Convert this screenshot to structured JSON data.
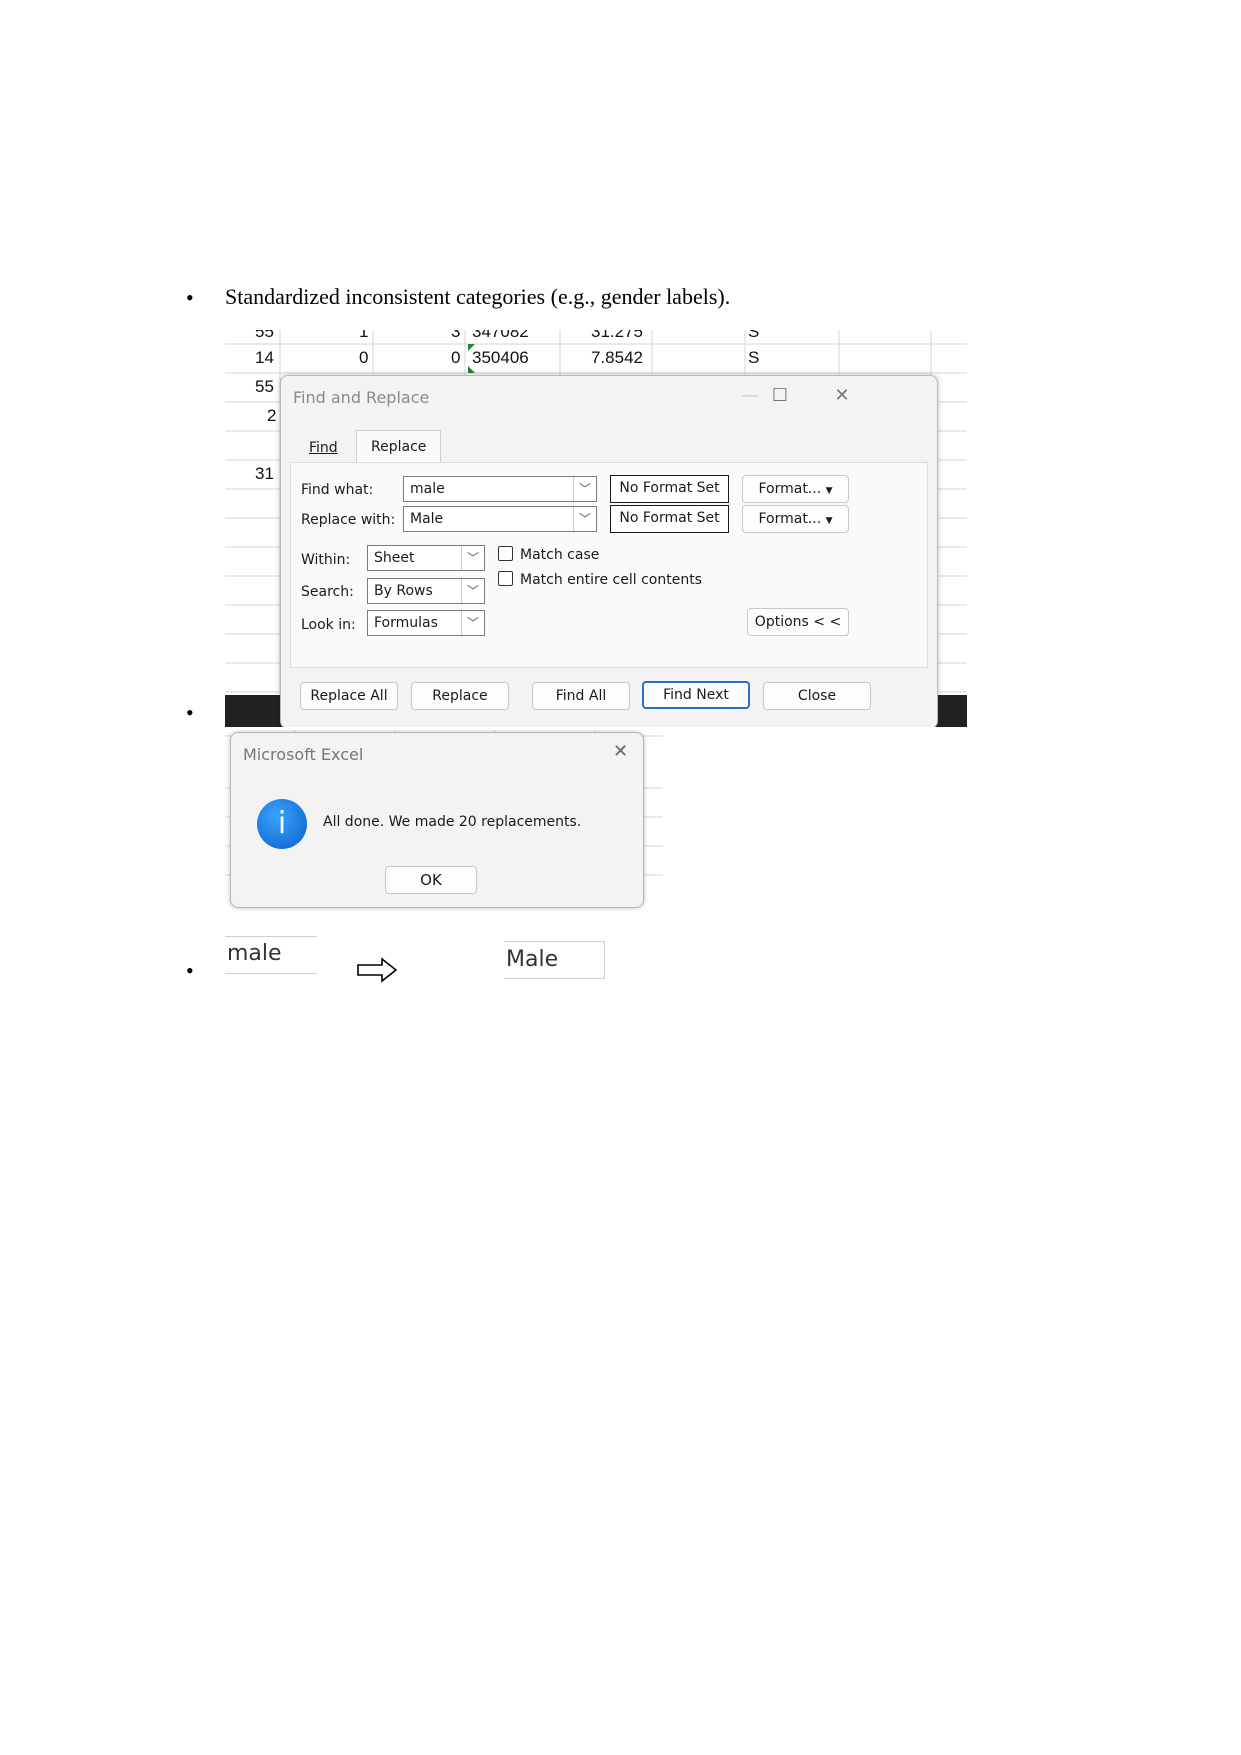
{
  "bullets": [
    {
      "text": "Standardized inconsistent categories (e.g., gender labels)."
    },
    {
      "text": ""
    },
    {
      "text": ""
    }
  ],
  "sheet": {
    "row_partial": [
      "55",
      "1",
      "3",
      "347082",
      "31.275",
      "S"
    ],
    "row_main": [
      "14",
      "0",
      "0",
      "350406",
      "7.8542",
      "S"
    ],
    "row_ids": [
      "55",
      "2",
      "31"
    ]
  },
  "find_replace": {
    "title": "Find and Replace",
    "tabs": [
      "Find",
      "Replace"
    ],
    "find_label": "Find what:",
    "find_value": "male",
    "replace_label": "Replace with:",
    "replace_value": "Male",
    "no_format": "No Format Set",
    "format_button": "Format...",
    "within_label": "Within:",
    "within_value": "Sheet",
    "search_label": "Search:",
    "search_value": "By Rows",
    "lookin_label": "Look in:",
    "lookin_value": "Formulas",
    "match_case": "Match case",
    "match_entire": "Match entire cell contents",
    "options_button": "Options < <",
    "buttons": [
      "Replace All",
      "Replace",
      "Find All",
      "Find Next",
      "Close"
    ]
  },
  "message_box": {
    "title": "Microsoft Excel",
    "message": "All done. We made 20 replacements.",
    "ok": "OK"
  },
  "example": {
    "before": "male",
    "after": "Male",
    "arrow_icon": "right-arrow-icon"
  }
}
